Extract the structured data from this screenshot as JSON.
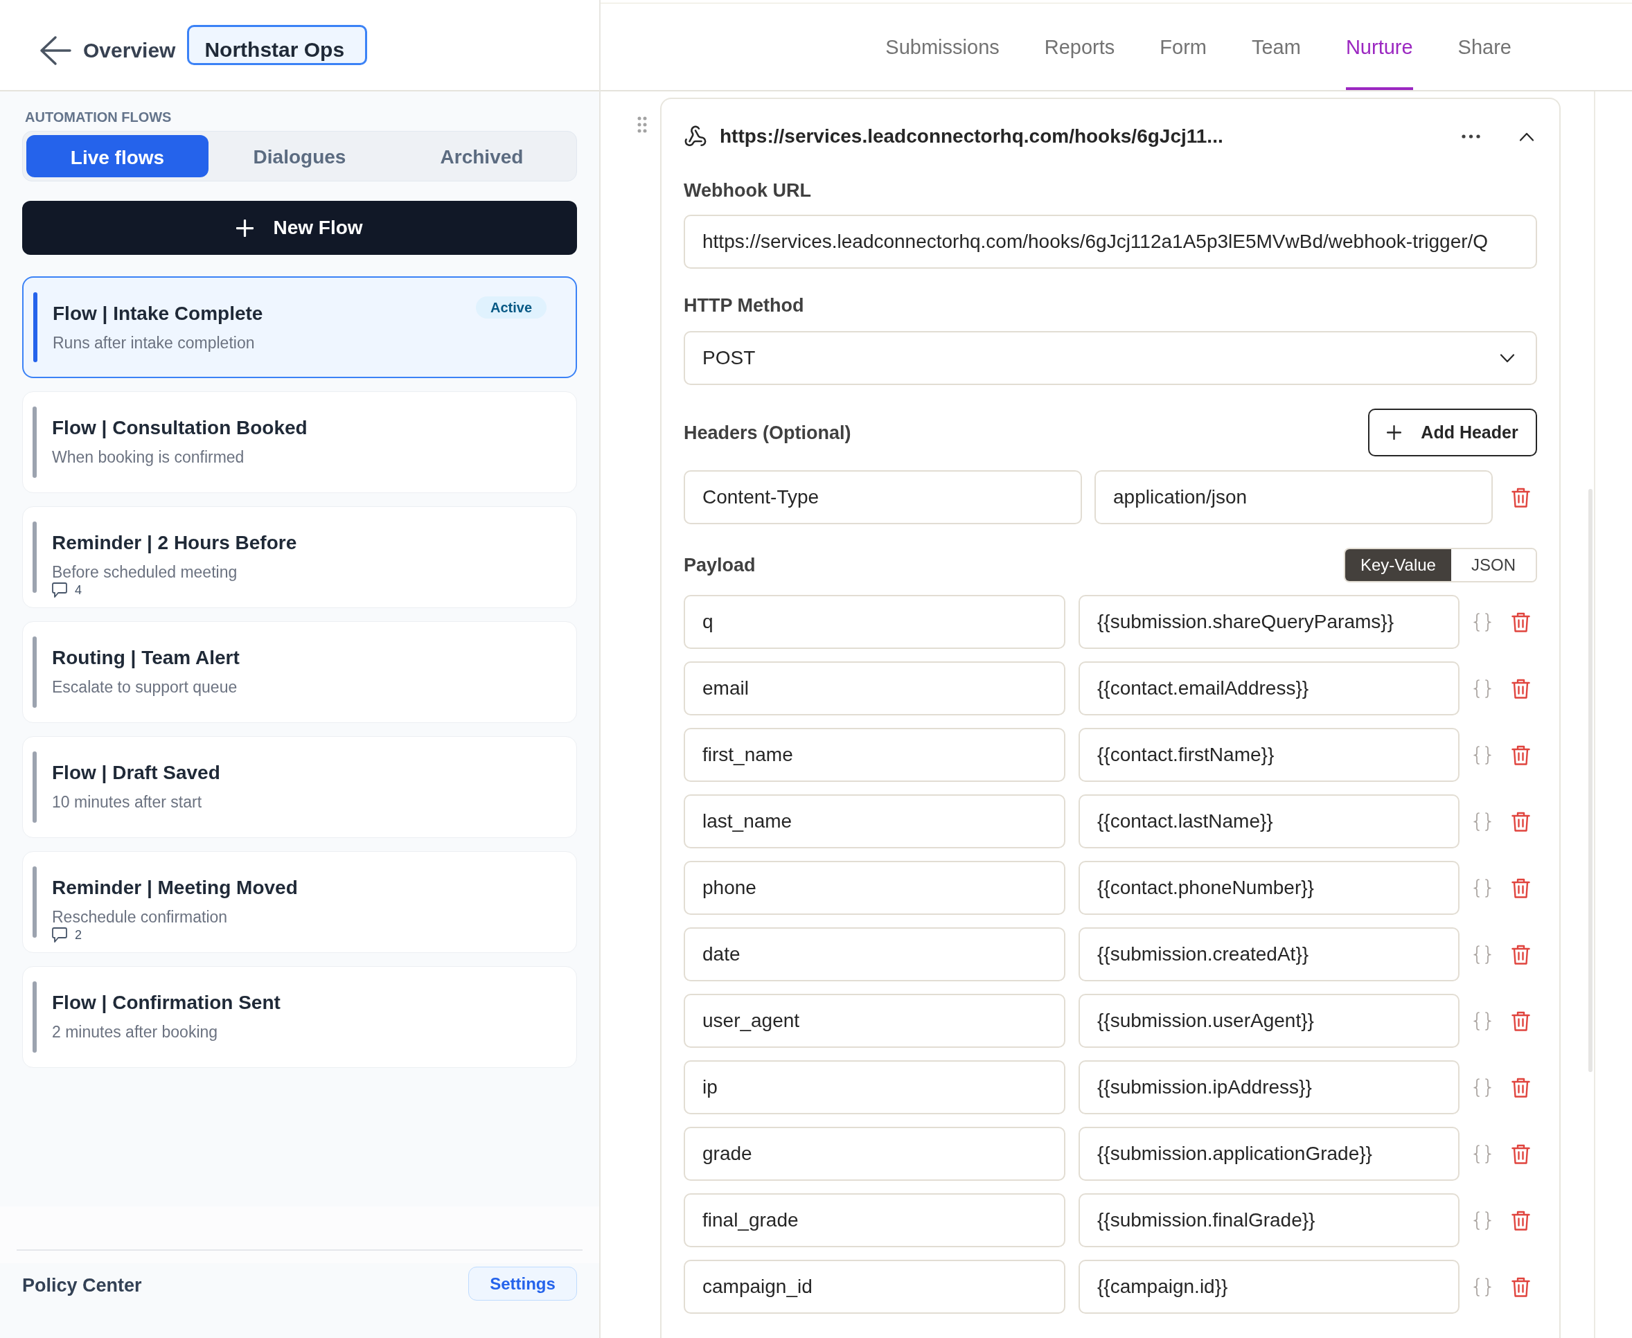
{
  "header": {
    "back_label": "Overview",
    "workspace": "Northstar Ops",
    "tabs": [
      {
        "label": "Submissions",
        "selected": false
      },
      {
        "label": "Reports",
        "selected": false
      },
      {
        "label": "Form",
        "selected": false
      },
      {
        "label": "Team",
        "selected": false
      },
      {
        "label": "Nurture",
        "selected": true
      },
      {
        "label": "Share",
        "selected": false
      }
    ]
  },
  "sidebar": {
    "section_title": "AUTOMATION FLOWS",
    "filter_tabs": [
      {
        "label": "Live flows",
        "selected": true
      },
      {
        "label": "Dialogues",
        "selected": false
      },
      {
        "label": "Archived",
        "selected": false
      }
    ],
    "new_flow_button": "New Flow",
    "flows": [
      {
        "title": "Flow | Intake Complete",
        "subtitle": "Runs after intake completion",
        "badge": "Active",
        "selected": true
      },
      {
        "title": "Flow | Consultation Booked",
        "subtitle": "When booking is confirmed",
        "selected": false
      },
      {
        "title": "Reminder | 2 Hours Before",
        "subtitle": "Before scheduled meeting",
        "comments": "4",
        "selected": false
      },
      {
        "title": "Routing | Team Alert",
        "subtitle": "Escalate to support queue",
        "selected": false
      },
      {
        "title": "Flow | Draft Saved",
        "subtitle": "10 minutes after start",
        "selected": false
      },
      {
        "title": "Reminder | Meeting Moved",
        "subtitle": "Reschedule confirmation",
        "comments": "2",
        "selected": false
      },
      {
        "title": "Flow | Confirmation Sent",
        "subtitle": "2 minutes after booking",
        "selected": false
      }
    ],
    "footer": {
      "title": "Policy Center",
      "button": "Settings"
    }
  },
  "webhook": {
    "title": "https://services.leadconnectorhq.com/hooks/6gJcj11...",
    "expanded": true,
    "url_label": "Webhook URL",
    "url": "https://services.leadconnectorhq.com/hooks/6gJcj112a1A5p3lE5MVwBd/webhook-trigger/Q",
    "method_label": "HTTP Method",
    "method": "POST",
    "headers_label": "Headers (Optional)",
    "add_header_button": "Add Header",
    "headers": [
      {
        "key": "Content-Type",
        "value": "application/json"
      }
    ],
    "payload_label": "Payload",
    "payload_modes": [
      {
        "label": "Key-Value",
        "selected": true
      },
      {
        "label": "JSON",
        "selected": false
      }
    ],
    "payload": [
      {
        "key": "q",
        "value": "{{submission.shareQueryParams}}"
      },
      {
        "key": "email",
        "value": "{{contact.emailAddress}}"
      },
      {
        "key": "first_name",
        "value": "{{contact.firstName}}"
      },
      {
        "key": "last_name",
        "value": "{{contact.lastName}}"
      },
      {
        "key": "phone",
        "value": "{{contact.phoneNumber}}"
      },
      {
        "key": "date",
        "value": "{{submission.createdAt}}"
      },
      {
        "key": "user_agent",
        "value": "{{submission.userAgent}}"
      },
      {
        "key": "ip",
        "value": "{{submission.ipAddress}}"
      },
      {
        "key": "grade",
        "value": "{{submission.applicationGrade}}"
      },
      {
        "key": "final_grade",
        "value": "{{submission.finalGrade}}"
      },
      {
        "key": "campaign_id",
        "value": "{{campaign.id}}"
      }
    ]
  }
}
